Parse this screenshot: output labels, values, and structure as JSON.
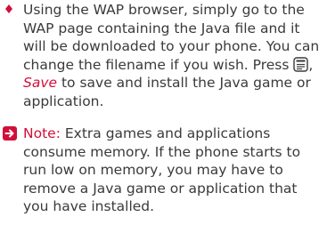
{
  "bullet": {
    "text_before_icon": "Using the WAP browser, simply go to the WAP page containing the Java file and it will be downloaded to your phone. You can change the filename if you wish. Press ",
    "icon": "menu-key-icon",
    "separator": ", ",
    "save_label": "Save",
    "text_after": " to save and install the Java game or application."
  },
  "note": {
    "icon": "arrow-right-box-icon",
    "label": "Note:",
    "text": " Extra games and applications consume memory. If the phone starts to run low on memory, you may have to remove a Java game or application that you have installed."
  },
  "colors": {
    "accent": "#d0103a",
    "body_text": "#3a3a3a"
  }
}
